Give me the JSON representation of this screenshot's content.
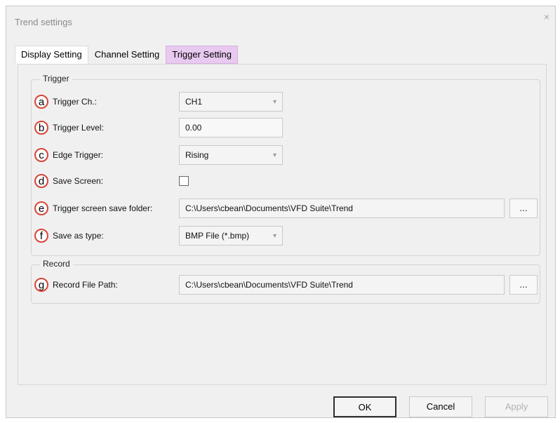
{
  "dialog": {
    "title": "Trend settings",
    "close_icon": "×"
  },
  "tabs": [
    {
      "label": "Display Setting"
    },
    {
      "label": "Channel Setting"
    },
    {
      "label": "Trigger Setting"
    }
  ],
  "trigger_group": {
    "title": "Trigger",
    "rows": [
      {
        "badge": "a",
        "label": "Trigger Ch.:",
        "value": "CH1"
      },
      {
        "badge": "b",
        "label": "Trigger Level:",
        "value": "0.00"
      },
      {
        "badge": "c",
        "label": "Edge Trigger:",
        "value": "Rising"
      },
      {
        "badge": "d",
        "label": "Save Screen:",
        "checked": false
      },
      {
        "badge": "e",
        "label": "Trigger screen save folder:",
        "value": "C:\\Users\\cbean\\Documents\\VFD Suite\\Trend"
      },
      {
        "badge": "f",
        "label": "Save as type:",
        "value": "BMP File (*.bmp)"
      }
    ]
  },
  "record_group": {
    "title": "Record",
    "row": {
      "badge": "g",
      "label": "Record File Path:",
      "value": "C:\\Users\\cbean\\Documents\\VFD Suite\\Trend"
    }
  },
  "browse_label": "...",
  "dropdown_icon": "▾",
  "buttons": {
    "ok": "OK",
    "cancel": "Cancel",
    "apply": "Apply"
  }
}
